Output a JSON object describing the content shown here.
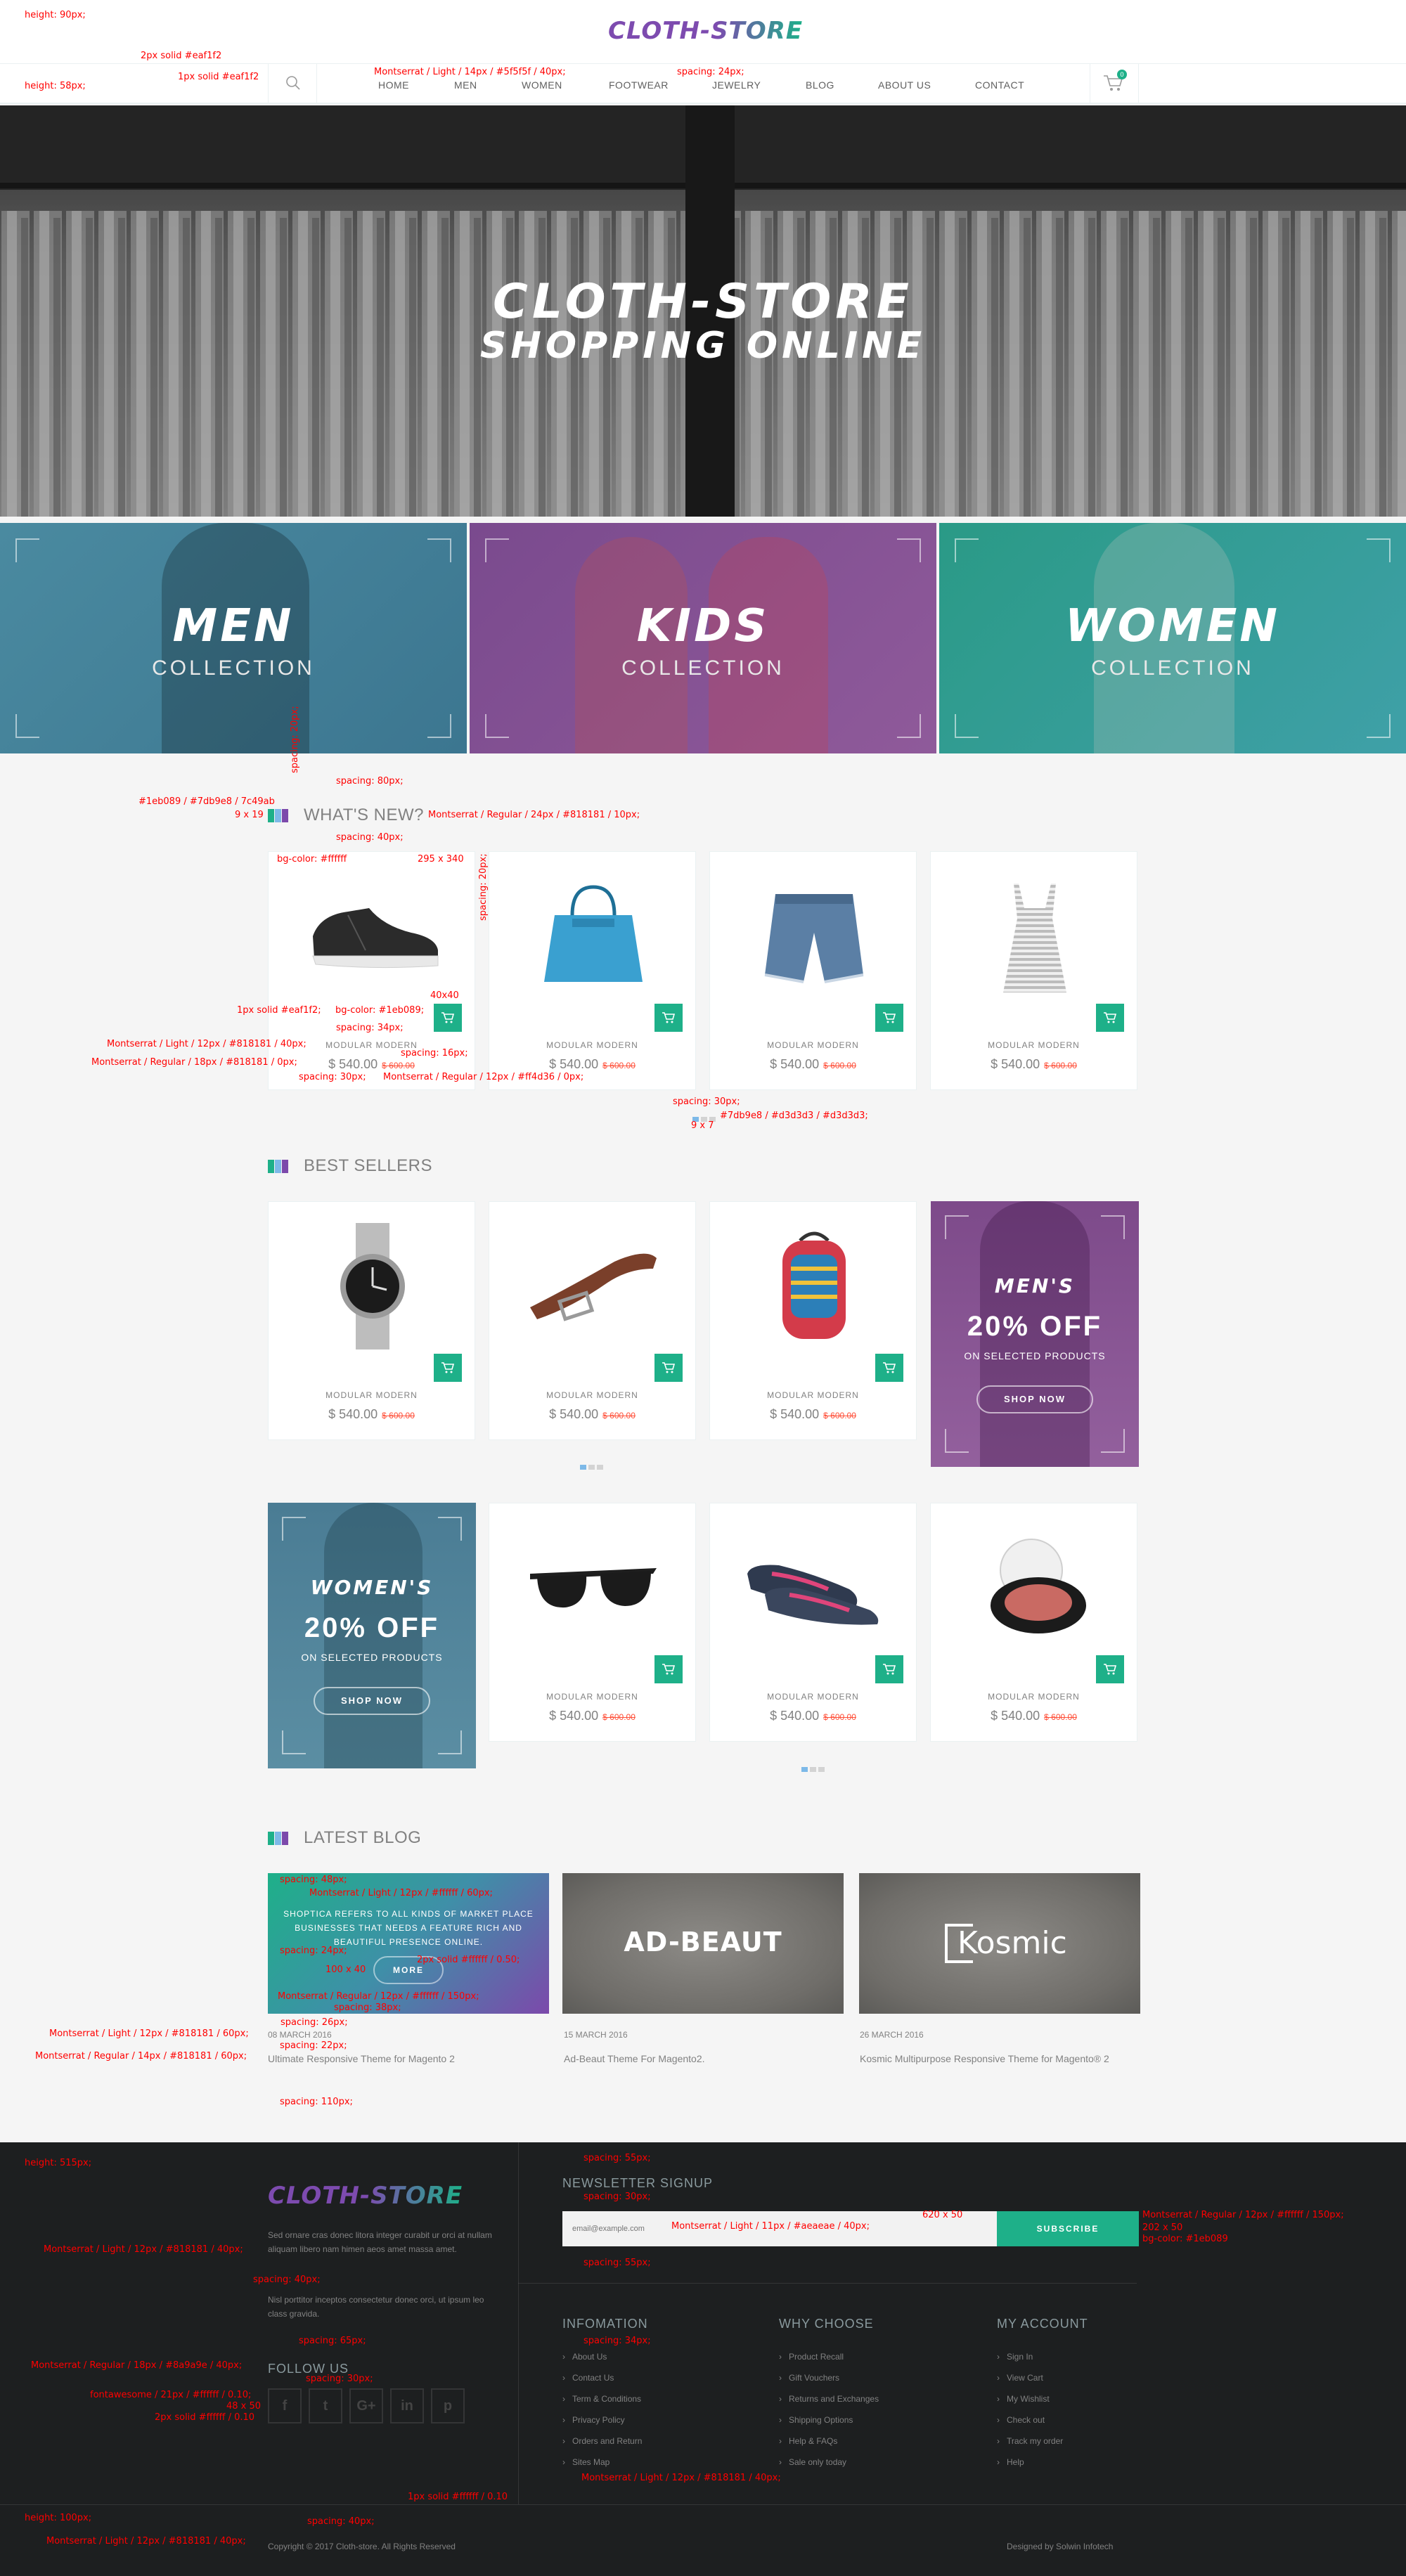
{
  "brand": {
    "logo": "CLOTH-STORE",
    "colors": {
      "purple": "#7d4baf",
      "teal": "#1eb089",
      "cyan": "#7db9e8"
    }
  },
  "nav": {
    "items": [
      "HOME",
      "MEN",
      "WOMEN",
      "FOOTWEAR",
      "JEWELRY",
      "BLOG",
      "ABOUT US",
      "CONTACT"
    ],
    "cart_count": "0"
  },
  "hero": {
    "line1": "CLOTH-STORE",
    "line2": "SHOPPING ONLINE"
  },
  "collections": [
    {
      "title": "MEN",
      "sub": "COLLECTION"
    },
    {
      "title": "KIDS",
      "sub": "COLLECTION"
    },
    {
      "title": "WOMEN",
      "sub": "COLLECTION"
    }
  ],
  "whats_new": {
    "heading": "WHAT'S NEW?",
    "products": [
      {
        "icon": "sneaker-icon",
        "brand": "MODULAR MODERN",
        "price": "$ 540.00",
        "old": "$ 600.00"
      },
      {
        "icon": "handbag-icon",
        "brand": "MODULAR MODERN",
        "price": "$ 540.00",
        "old": "$ 600.00"
      },
      {
        "icon": "shorts-icon",
        "brand": "MODULAR MODERN",
        "price": "$ 540.00",
        "old": "$ 600.00"
      },
      {
        "icon": "tank-top-icon",
        "brand": "MODULAR MODERN",
        "price": "$ 540.00",
        "old": "$ 600.00"
      }
    ]
  },
  "best_sellers": {
    "heading": "BEST SELLERS",
    "products": [
      {
        "icon": "watch-icon",
        "brand": "MODULAR MODERN",
        "price": "$ 540.00",
        "old": "$ 600.00"
      },
      {
        "icon": "belt-icon",
        "brand": "MODULAR MODERN",
        "price": "$ 540.00",
        "old": "$ 600.00"
      },
      {
        "icon": "backpack-icon",
        "brand": "MODULAR MODERN",
        "price": "$ 540.00",
        "old": "$ 600.00"
      }
    ],
    "products2": [
      {
        "icon": "sunglasses-icon",
        "brand": "MODULAR MODERN",
        "price": "$ 540.00",
        "old": "$ 600.00"
      },
      {
        "icon": "shoes-icon",
        "brand": "MODULAR MODERN",
        "price": "$ 540.00",
        "old": "$ 600.00"
      },
      {
        "icon": "blush-icon",
        "brand": "MODULAR MODERN",
        "price": "$ 540.00",
        "old": "$ 600.00"
      }
    ]
  },
  "promos": {
    "men": {
      "title": "MEN'S",
      "discount": "20% OFF",
      "sub": "ON SELECTED PRODUCTS",
      "button": "SHOP NOW"
    },
    "women": {
      "title": "WOMEN'S",
      "discount": "20% OFF",
      "sub": "ON SELECTED PRODUCTS",
      "button": "SHOP NOW"
    }
  },
  "latest_blog": {
    "heading": "LATEST BLOG",
    "feature": {
      "text": "SHOPTICA REFERS TO ALL KINDS OF MARKET PLACE BUSINESSES THAT NEEDS A FEATURE RICH AND BEAUTIFUL PRESENCE ONLINE.",
      "button": "MORE"
    },
    "posts": [
      {
        "date": "08 MARCH 2016",
        "title": "Ultimate Responsive Theme for Magento 2",
        "img_text": ""
      },
      {
        "date": "15 MARCH 2016",
        "title": "Ad-Beaut Theme For Magento2.",
        "img_text": "AD-BEAUT"
      },
      {
        "date": "26 MARCH 2016",
        "title": "Kosmic Multipurpose Responsive Theme for Magento® 2",
        "img_text": "Kosmic"
      }
    ]
  },
  "footer": {
    "logo": "CLOTH-STORE",
    "about1": "Sed ornare cras donec litora integer curabit ur orci at nullam aliquam libero nam himen aeos amet massa amet.",
    "about2": "Nisl porttitor inceptos consectetur donec orci, ut ipsum leo class gravida.",
    "follow_heading": "FOLLOW US",
    "social": [
      "f",
      "t",
      "G+",
      "in",
      "p"
    ],
    "newsletter_heading": "NEWSLETTER SIGNUP",
    "email_placeholder": "email@example.com",
    "subscribe": "SUBSCRIBE",
    "cols": [
      {
        "heading": "INFOMATION",
        "links": [
          "About Us",
          "Contact Us",
          "Term & Conditions",
          "Privacy Policy",
          "Orders and Return",
          "Sites Map"
        ]
      },
      {
        "heading": "WHY CHOOSE",
        "links": [
          "Product Recall",
          "Gift Vouchers",
          "Returns and Exchanges",
          "Shipping Options",
          "Help & FAQs",
          "Sale only today"
        ]
      },
      {
        "heading": "MY ACCOUNT",
        "links": [
          "Sign In",
          "View Cart",
          "My Wishlist",
          "Check out",
          "Track my order",
          "Help"
        ]
      }
    ],
    "copyright": "Copyright © 2017 Cloth-store. All Rights Reserved",
    "designed": "Designed by Solwin Infotech"
  },
  "annotations": [
    "height: 90px;",
    "2px solid #eaf1f2",
    "1px solid #eaf1f2",
    "height: 58px;",
    "Montserrat / Light / 14px / #5f5f5f / 40px;",
    "spacing: 24px;",
    "#1eb089 / #7db9e8 / 7c49ab",
    "9 x 19",
    "spacing: 20px;",
    "spacing: 80px;",
    "Montserrat / Regular / 24px / #818181 / 10px;",
    "spacing: 40px;",
    "bg-color: #ffffff",
    "295 x 340",
    "spacing: 20px;",
    "40x40",
    "1px solid #eaf1f2;",
    "bg-color: #1eb089;",
    "spacing: 34px;",
    "Montserrat / Light / 12px / #818181 / 40px;",
    "spacing: 16px;",
    "Montserrat / Regular / 18px / #818181 / 0px;",
    "spacing: 30px;",
    "Montserrat / Regular / 12px / #ff4d36 / 0px;",
    "spacing: 30px;",
    "#7db9e8 / #d3d3d3 / #d3d3d3;",
    "9 x 7",
    "spacing: 48px;",
    "Montserrat / Light / 12px / #ffffff / 60px;",
    "spacing: 24px;",
    "100 x 40",
    "2px solid #ffffff / 0.50;",
    "Montserrat / Regular / 12px / #ffffff / 150px;",
    "spacing: 38px;",
    "spacing: 26px;",
    "Montserrat / Light / 12px / #818181 / 60px;",
    "spacing: 22px;",
    "Montserrat / Regular / 14px / #818181 / 60px;",
    "spacing: 110px;",
    "height: 515px;",
    "spacing: 55px;",
    "spacing: 30px;",
    "620 x 50",
    "Montserrat / Light / 11px / #aeaeae / 40px;",
    "Montserrat / Regular / 12px / #ffffff / 150px;",
    "202 x 50",
    "bg-color: #1eb089",
    "spacing: 55px;",
    "Montserrat / Light / 12px / #818181 / 40px;",
    "spacing: 40px;",
    "spacing: 65px;",
    "spacing: 34px;",
    "Montserrat / Regular / 18px / #8a9a9e / 40px;",
    "spacing: 30px;",
    "fontawesome / 21px / #ffffff / 0.10;",
    "48 x 50",
    "2px solid #ffffff / 0.10",
    "Montserrat / Light / 12px / #818181 / 40px;",
    "1px solid #ffffff / 0.10",
    "height: 100px;",
    "spacing: 40px;",
    "Montserrat / Light / 12px / #818181 / 40px;"
  ]
}
